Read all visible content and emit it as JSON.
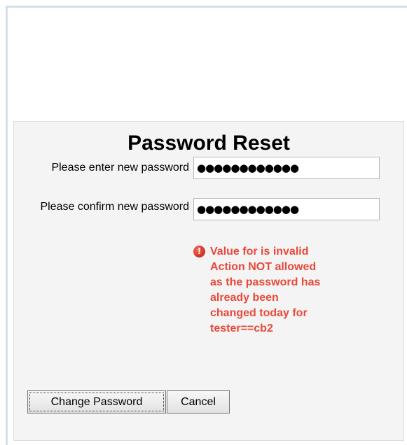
{
  "page": {
    "title": "Password Reset"
  },
  "form": {
    "new_password": {
      "label": "Please enter new password",
      "value": "●●●●●●●●●●●●"
    },
    "confirm_password": {
      "label": "Please confirm new password",
      "value": "●●●●●●●●●●●●"
    }
  },
  "error": {
    "icon": "exclamation-circle-icon",
    "icon_glyph": "!",
    "message": "Value for  is invalid\nAction NOT allowed\nas the password has\nalready been\nchanged today for\ntester==cb2",
    "color": "#e8493a"
  },
  "buttons": {
    "change_password": "Change Password",
    "cancel": "Cancel"
  }
}
